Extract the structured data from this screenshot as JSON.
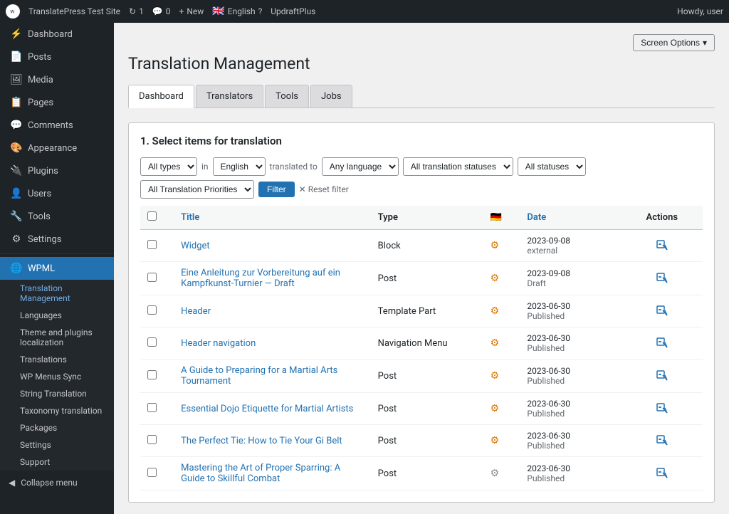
{
  "adminbar": {
    "logo_alt": "WordPress",
    "site_name": "TranslatePress Test Site",
    "updates_count": "1",
    "comments_count": "0",
    "new_label": "New",
    "language_flag": "🇬🇧",
    "language": "English",
    "help_icon": "?",
    "plugin_label": "UpdraftPlus",
    "howdy": "Howdy, user",
    "screen_options": "Screen Options"
  },
  "sidebar": {
    "menu_items": [
      {
        "id": "dashboard",
        "label": "Dashboard",
        "icon": "⚡"
      },
      {
        "id": "posts",
        "label": "Posts",
        "icon": "📄"
      },
      {
        "id": "media",
        "label": "Media",
        "icon": "🖼"
      },
      {
        "id": "pages",
        "label": "Pages",
        "icon": "📋"
      },
      {
        "id": "comments",
        "label": "Comments",
        "icon": "💬"
      },
      {
        "id": "appearance",
        "label": "Appearance",
        "icon": "🎨"
      },
      {
        "id": "plugins",
        "label": "Plugins",
        "icon": "🔌"
      },
      {
        "id": "users",
        "label": "Users",
        "icon": "👤"
      },
      {
        "id": "tools",
        "label": "Tools",
        "icon": "🔧"
      },
      {
        "id": "settings",
        "label": "Settings",
        "icon": "⚙"
      }
    ],
    "wpml_label": "WPML",
    "wpml_submenu": [
      {
        "id": "translation-management",
        "label": "Translation Management"
      },
      {
        "id": "languages",
        "label": "Languages"
      },
      {
        "id": "theme-plugins-localization",
        "label": "Theme and plugins localization"
      },
      {
        "id": "translations",
        "label": "Translations"
      },
      {
        "id": "wp-menus-sync",
        "label": "WP Menus Sync"
      },
      {
        "id": "string-translation",
        "label": "String Translation"
      },
      {
        "id": "taxonomy-translation",
        "label": "Taxonomy translation"
      },
      {
        "id": "packages",
        "label": "Packages"
      },
      {
        "id": "settings",
        "label": "Settings"
      },
      {
        "id": "support",
        "label": "Support"
      }
    ],
    "collapse_label": "Collapse menu"
  },
  "page": {
    "title": "Translation Management",
    "screen_options": "Screen Options"
  },
  "tabs": [
    {
      "id": "dashboard",
      "label": "Dashboard",
      "active": true
    },
    {
      "id": "translators",
      "label": "Translators",
      "active": false
    },
    {
      "id": "tools",
      "label": "Tools",
      "active": false
    },
    {
      "id": "jobs",
      "label": "Jobs",
      "active": false
    }
  ],
  "filters": {
    "section_title": "1. Select items for translation",
    "type_options": [
      "All types"
    ],
    "in_label": "in",
    "language_options": [
      "English"
    ],
    "translated_to_label": "translated to",
    "any_language_options": [
      "Any language"
    ],
    "translation_status_options": [
      "All translation statuses"
    ],
    "status_options": [
      "All statuses"
    ],
    "priority_options": [
      "All Translation Priorities"
    ],
    "filter_btn": "Filter",
    "reset_filter": "Reset filter"
  },
  "table": {
    "headers": {
      "checkbox": "",
      "title": "Title",
      "type": "Type",
      "flag": "🇩🇪",
      "date": "Date",
      "actions": "Actions"
    },
    "rows": [
      {
        "id": 1,
        "title": "Widget",
        "type": "Block",
        "date": "2023-09-08",
        "status": "external",
        "icon_type": "orange"
      },
      {
        "id": 2,
        "title": "Eine Anleitung zur Vorbereitung auf ein Kampfkunst-Turnier — Draft",
        "type": "Post",
        "date": "2023-09-08",
        "status": "Draft",
        "icon_type": "orange"
      },
      {
        "id": 3,
        "title": "Header",
        "type": "Template Part",
        "date": "2023-06-30",
        "status": "Published",
        "icon_type": "orange"
      },
      {
        "id": 4,
        "title": "Header navigation",
        "type": "Navigation Menu",
        "date": "2023-06-30",
        "status": "Published",
        "icon_type": "orange"
      },
      {
        "id": 5,
        "title": "A Guide to Preparing for a Martial Arts Tournament",
        "type": "Post",
        "date": "2023-06-30",
        "status": "Published",
        "icon_type": "orange"
      },
      {
        "id": 6,
        "title": "Essential Dojo Etiquette for Martial Artists",
        "type": "Post",
        "date": "2023-06-30",
        "status": "Published",
        "icon_type": "orange"
      },
      {
        "id": 7,
        "title": "The Perfect Tie: How to Tie Your Gi Belt",
        "type": "Post",
        "date": "2023-06-30",
        "status": "Published",
        "icon_type": "orange"
      },
      {
        "id": 8,
        "title": "Mastering the Art of Proper Sparring: A Guide to Skillful Combat",
        "type": "Post",
        "date": "2023-06-30",
        "status": "Published",
        "icon_type": "gray"
      }
    ]
  }
}
